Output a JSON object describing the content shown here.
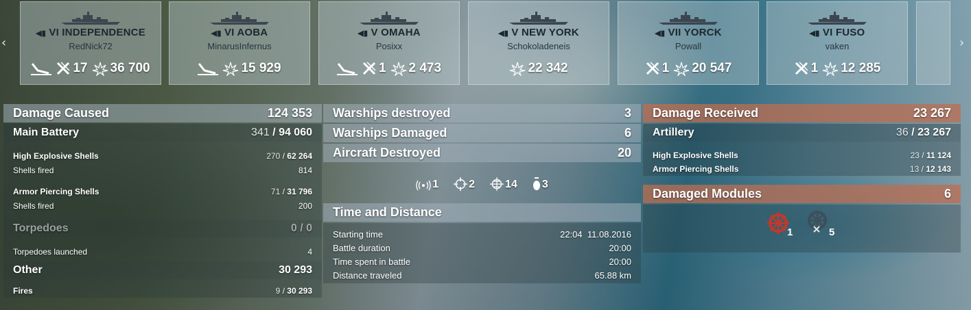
{
  "nav": {
    "left_arrow": "‹",
    "right_arrow": "›"
  },
  "ships": [
    {
      "name": "VI INDEPENDENCE",
      "player": "RedNick72",
      "planes": "17",
      "damage": "36 700",
      "show_torp": true,
      "show_planes": true
    },
    {
      "name": "VI AOBA",
      "player": "MinarusInfernus",
      "planes": "",
      "damage": "15 929",
      "show_torp": true,
      "show_planes": false
    },
    {
      "name": "V OMAHA",
      "player": "Posixx",
      "planes": "1",
      "damage": "2 473",
      "show_torp": true,
      "show_planes": true
    },
    {
      "name": "V NEW YORK",
      "player": "Schokoladeneis",
      "planes": "",
      "damage": "22 342",
      "show_torp": false,
      "show_planes": false
    },
    {
      "name": "VII YORCK",
      "player": "Powall",
      "planes": "1",
      "damage": "20 547",
      "show_torp": false,
      "show_planes": true
    },
    {
      "name": "VI FUSO",
      "player": "vaken",
      "planes": "1",
      "damage": "12 285",
      "show_torp": false,
      "show_planes": true
    }
  ],
  "damage_caused": {
    "title": "Damage Caused",
    "total": "124 353",
    "main_battery": {
      "label": "Main Battery",
      "hits": "341",
      "value": "94 060"
    },
    "he": {
      "label": "High Explosive Shells",
      "hits": "270",
      "value": "62 264"
    },
    "he_fired": {
      "label": "Shells fired",
      "value": "814"
    },
    "ap": {
      "label": "Armor Piercing Shells",
      "hits": "71",
      "value": "31 796"
    },
    "ap_fired": {
      "label": "Shells fired",
      "value": "200"
    },
    "torpedoes": {
      "label": "Torpedoes",
      "hits": "0",
      "value": "0"
    },
    "torp_launched": {
      "label": "Torpedoes launched",
      "value": "4"
    },
    "other": {
      "label": "Other",
      "value": "30 293"
    },
    "fires": {
      "label": "Fires",
      "hits": "9",
      "value": "30 293"
    }
  },
  "middle": {
    "destroyed": {
      "label": "Warships destroyed",
      "value": "3"
    },
    "damaged": {
      "label": "Warships Damaged",
      "value": "6"
    },
    "aircraft": {
      "label": "Aircraft Destroyed",
      "value": "20"
    },
    "icons": [
      {
        "icon": "radar-spotting-icon",
        "value": "1"
      },
      {
        "icon": "crosshair-icon",
        "value": "2"
      },
      {
        "icon": "crosshair-grid-icon",
        "value": "14"
      },
      {
        "icon": "capture-icon",
        "value": "3"
      }
    ],
    "time_title": "Time and Distance",
    "start": {
      "label": "Starting time",
      "time": "22:04",
      "date": "11.08.2016"
    },
    "duration": {
      "label": "Battle duration",
      "value": "20:00"
    },
    "spent": {
      "label": "Time spent in battle",
      "value": "20:00"
    },
    "distance": {
      "label": "Distance traveled",
      "value": "65.88 km"
    }
  },
  "damage_received": {
    "title": "Damage Received",
    "total": "23 267",
    "artillery": {
      "label": "Artillery",
      "hits": "36",
      "value": "23 267"
    },
    "he": {
      "label": "High Explosive Shells",
      "hits": "23",
      "value": "11 124"
    },
    "ap": {
      "label": "Armor Piercing Shells",
      "hits": "13",
      "value": "12 143"
    },
    "modules_title": "Damaged Modules",
    "modules_total": "6",
    "steering_count": "1",
    "steering_x_count": "5"
  },
  "colors": {
    "orange": "#be6e50",
    "steering": "#c0392b"
  }
}
